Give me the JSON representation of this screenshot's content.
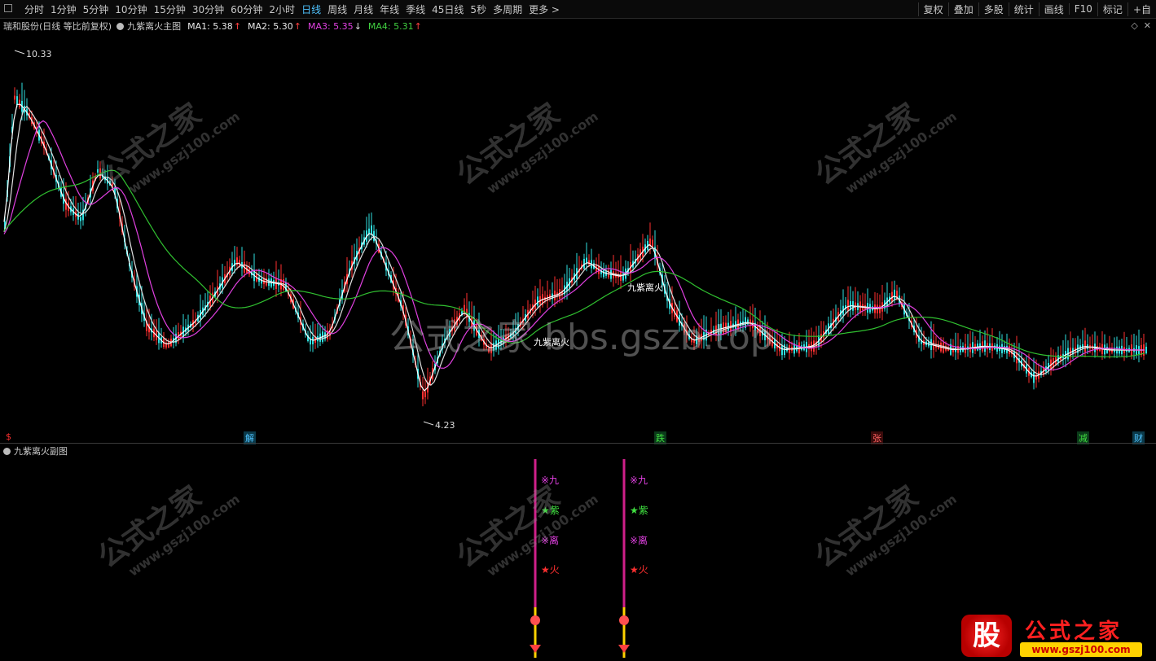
{
  "toolbar": {
    "periods": [
      "分时",
      "1分钟",
      "5分钟",
      "10分钟",
      "15分钟",
      "30分钟",
      "60分钟",
      "2小时",
      "日线",
      "周线",
      "月线",
      "年线",
      "季线",
      "45日线",
      "5秒",
      "多周期",
      "更多 >"
    ],
    "active_period": "日线",
    "tools": [
      "复权",
      "叠加",
      "多股",
      "统计",
      "画线",
      "F10",
      "标记",
      "+自"
    ]
  },
  "info": {
    "stock": "瑞和股份(日线 等比前复权)",
    "indicator": "九紫离火主图",
    "ma1_label": "MA1: 5.38",
    "ma1_arrow": "↑",
    "ma2_label": "MA2: 5.30",
    "ma2_arrow": "↑",
    "ma3_label": "MA3: 5.35",
    "ma3_arrow": "↓",
    "ma4_label": "MA4: 5.31",
    "ma4_arrow": "↑"
  },
  "main_chart": {
    "high_label": "10.33",
    "low_label": "4.23",
    "signal_label_1": "九紫离火",
    "signal_label_2": "九紫离火",
    "event_markers": [
      "$",
      "解",
      "跌",
      "张",
      "减",
      "财"
    ],
    "colors": {
      "ma_short": "#ffffff",
      "ma_mid": "#e040e0",
      "ma_long": "#30c030",
      "up": "#ff3030",
      "down": "#30e0e0"
    }
  },
  "sub_chart": {
    "title": "九紫离火副图",
    "columns": [
      {
        "chars": [
          "※九",
          "★紫",
          "※离",
          "★火"
        ]
      },
      {
        "chars": [
          "※九",
          "★紫",
          "※离",
          "★火"
        ]
      }
    ]
  },
  "watermarks": {
    "brand": "公式之家",
    "url": "www.gszj100.com",
    "center_text": "公式之家 bbs.gszb.top"
  },
  "logo": {
    "badge": "股",
    "name": "公式之家",
    "url": "www.gszj100.com"
  }
}
